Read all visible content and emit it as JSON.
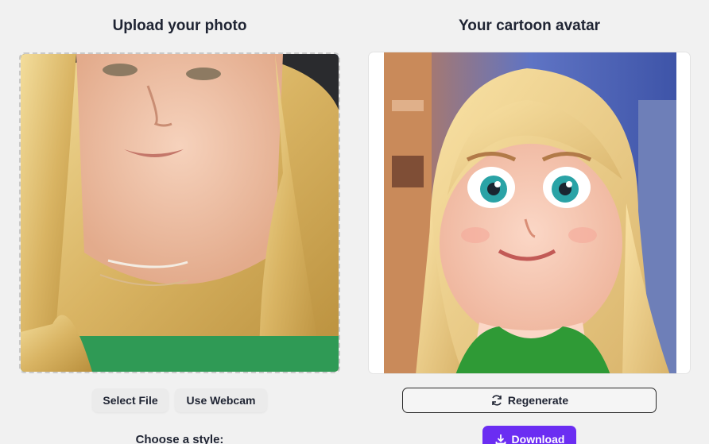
{
  "upload": {
    "title": "Upload your photo",
    "select_file_label": "Select File",
    "webcam_label": "Use Webcam",
    "style_prompt": "Choose a style:"
  },
  "result": {
    "title": "Your cartoon avatar",
    "regenerate_label": "Regenerate",
    "download_label": "Download"
  },
  "icons": {
    "regenerate": "refresh-icon",
    "download": "download-icon"
  },
  "colors": {
    "background": "#f1f1f1",
    "accent": "#6b2df2",
    "text": "#1f2433"
  }
}
